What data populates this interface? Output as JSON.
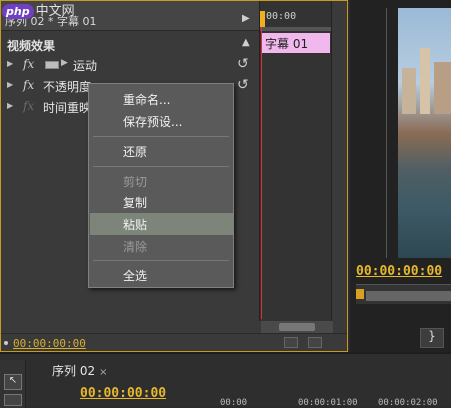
{
  "effect_controls": {
    "clip_title": "序列 02 * 字幕 01",
    "section_title": "视频效果",
    "effects": [
      {
        "label": "运动"
      },
      {
        "label": "不透明度"
      },
      {
        "label": "时间重映射"
      }
    ],
    "fx_symbol": "fx",
    "timeline_start": "00:00",
    "clip_block_label": "字幕 01",
    "footer_time": "00:00:00:00"
  },
  "context_menu": {
    "items": [
      {
        "label": "重命名...",
        "enabled": true
      },
      {
        "label": "保存预设...",
        "enabled": true
      },
      {
        "label": "还原",
        "enabled": true
      },
      {
        "label": "剪切",
        "enabled": false
      },
      {
        "label": "复制",
        "enabled": true
      },
      {
        "label": "粘贴",
        "enabled": true,
        "highlighted": true
      },
      {
        "label": "清除",
        "enabled": false
      },
      {
        "label": "全选",
        "enabled": true
      }
    ]
  },
  "program_monitor": {
    "time": "00:00:00:00",
    "button_symbol": "}"
  },
  "timeline": {
    "sequence_tab": "序列 02",
    "close_symbol": "×",
    "time": "00:00:00:00",
    "ruler_labels": [
      "00:00",
      "00:00:01:00",
      "00:00:02:00"
    ]
  },
  "watermark": {
    "logo_text": "php",
    "site_text": "中文网"
  },
  "colors": {
    "accent_time": "#e7b82b",
    "clip_block": "#f0b8ec",
    "playhead": "#e03030",
    "menu_highlight": "#7d8479"
  }
}
